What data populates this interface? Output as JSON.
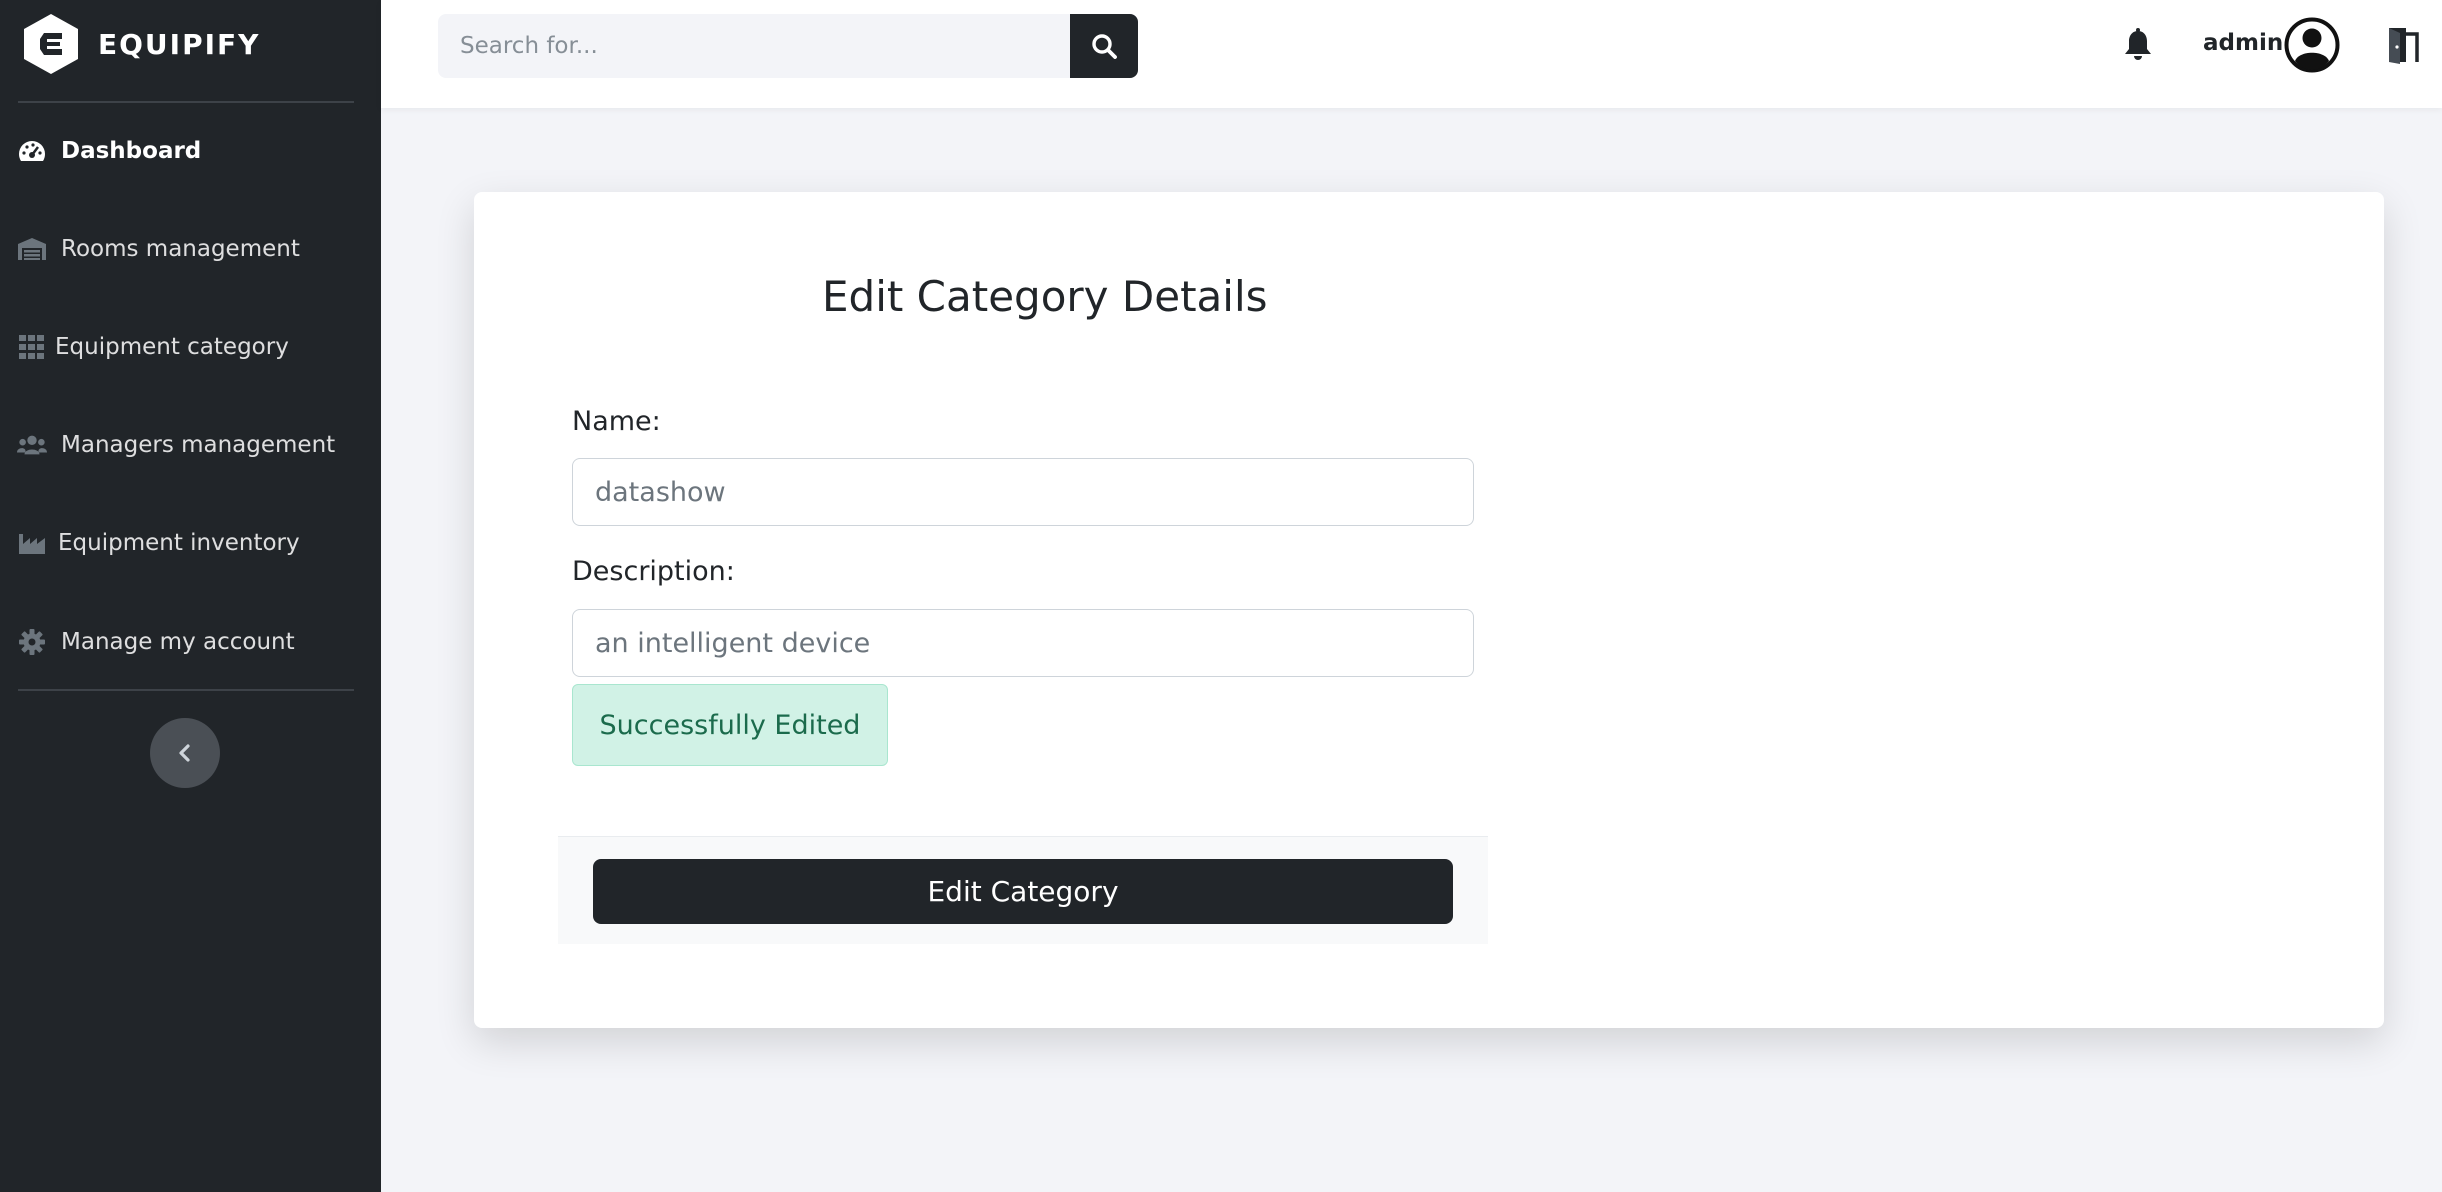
{
  "brand": {
    "name": "EQUIPIFY"
  },
  "sidebar": {
    "items": [
      {
        "label": "Dashboard",
        "icon": "gauge-icon",
        "active": true
      },
      {
        "label": "Rooms management",
        "icon": "warehouse-icon",
        "active": false
      },
      {
        "label": "Equipment category",
        "icon": "grid-icon",
        "active": false
      },
      {
        "label": "Managers management",
        "icon": "users-icon",
        "active": false
      },
      {
        "label": "Equipment inventory",
        "icon": "industry-icon",
        "active": false
      },
      {
        "label": "Manage my account",
        "icon": "gear-icon",
        "active": false
      }
    ],
    "collapse_icon": "chevron-left-icon"
  },
  "topbar": {
    "search_placeholder": "Search for...",
    "search_icon": "search-icon",
    "notification_icon": "bell-icon",
    "user_name": "admin",
    "avatar_icon": "user-circle-icon",
    "logout_icon": "door-exit-icon"
  },
  "form": {
    "title": "Edit Category Details",
    "name_label": "Name:",
    "name_placeholder": "datashow",
    "description_label": "Description:",
    "description_placeholder": "an intelligent device",
    "success_message": "Successfully Edited",
    "submit_label": "Edit Category"
  },
  "colors": {
    "sidebar_bg": "#212529",
    "page_bg": "#f3f4f8",
    "primary_dark": "#212529",
    "success_bg": "#d1f2e6",
    "success_text": "#1b6b4c"
  }
}
